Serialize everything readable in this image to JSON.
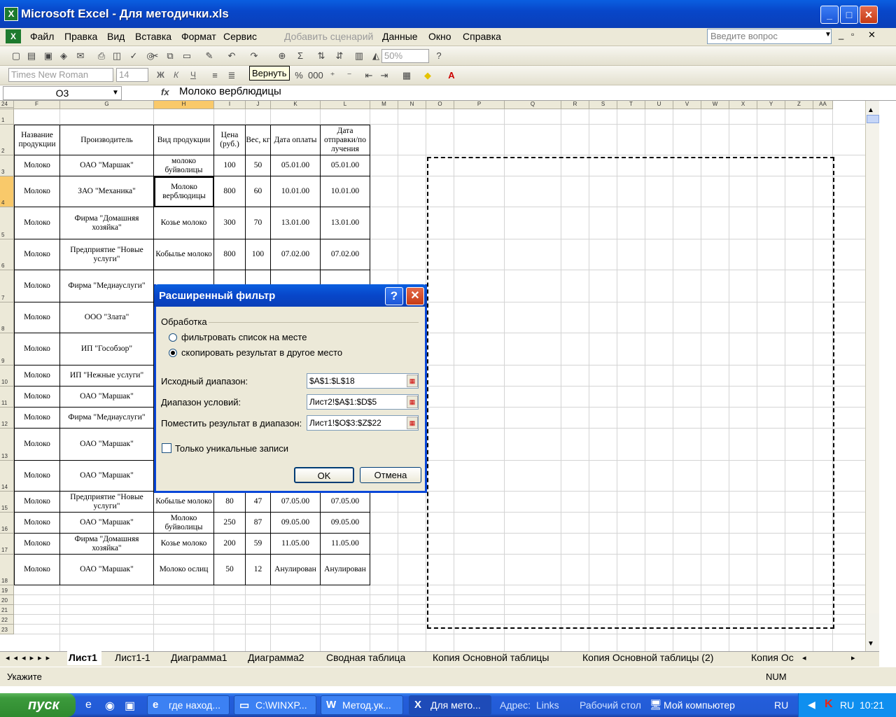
{
  "window": {
    "title": "Microsoft Excel - Для методички.xls"
  },
  "menu": [
    "Файл",
    "Правка",
    "Вид",
    "Вставка",
    "Формат",
    "Сервис",
    "Добавить сценарий",
    "Данные",
    "Окно",
    "Справка"
  ],
  "ask_placeholder": "Введите вопрос",
  "toolbar": {
    "zoom": "50%",
    "font": "Times New Roman",
    "size": "14",
    "tooltip": "Вернуть",
    "bold": "Ж",
    "italic": "К",
    "underline": "Ч"
  },
  "formula": {
    "namebox": "O3",
    "fx": "fx",
    "value": "Молоко верблюдицы"
  },
  "columns": [
    "F",
    "G",
    "H",
    "I",
    "J",
    "K",
    "L",
    "M",
    "N",
    "O",
    "P",
    "Q",
    "R",
    "S",
    "T",
    "U",
    "V",
    "W",
    "X",
    "Y",
    "Z",
    "AA"
  ],
  "rows": [
    "1",
    "2",
    "3",
    "4",
    "5",
    "6",
    "7",
    "8",
    "9",
    "10",
    "11",
    "12",
    "13",
    "14",
    "15",
    "16",
    "17",
    "18",
    "19",
    "20",
    "21",
    "22",
    "23",
    "24"
  ],
  "table": {
    "headers": [
      "Название продукции",
      "Производитель",
      "Вид продукции",
      "Цена (руб.)",
      "Вес, кг",
      "Дата оплаты",
      "Дата отправки/по лучения"
    ],
    "rows": [
      [
        "Молоко",
        "ОАО \"Маршак\"",
        "молоко буйволицы",
        "100",
        "50",
        "05.01.00",
        "05.01.00"
      ],
      [
        "Молоко",
        "ЗАО \"Механика\"",
        "Молоко верблюдицы",
        "800",
        "60",
        "10.01.00",
        "10.01.00"
      ],
      [
        "Молоко",
        "Фирма \"Домашняя хозяйка\"",
        "Козье молоко",
        "300",
        "70",
        "13.01.00",
        "13.01.00"
      ],
      [
        "Молоко",
        "Предприятие \"Новые услуги\"",
        "Кобылье молоко",
        "800",
        "100",
        "07.02.00",
        "07.02.00"
      ],
      [
        "Молоко",
        "Фирма \"Медиауслуги\"",
        "",
        "",
        "",
        "",
        ""
      ],
      [
        "Молоко",
        "ООО \"Злата\"",
        "",
        "",
        "",
        "",
        ""
      ],
      [
        "Молоко",
        "ИП \"Гособзор\"",
        "",
        "",
        "",
        "",
        ""
      ],
      [
        "Молоко",
        "ИП \"Нежные услуги\"",
        "",
        "",
        "",
        "",
        ""
      ],
      [
        "Молоко",
        "ОАО \"Маршак\"",
        "",
        "",
        "",
        "",
        ""
      ],
      [
        "Молоко",
        "Фирма \"Медиауслуги\"",
        "",
        "",
        "",
        "",
        ""
      ],
      [
        "Молоко",
        "ОАО \"Маршак\"",
        "",
        "",
        "",
        "",
        ""
      ],
      [
        "Молоко",
        "ОАО \"Маршак\"",
        "",
        "",
        "",
        "",
        ""
      ],
      [
        "Молоко",
        "Предприятие \"Новые услуги\"",
        "Кобылье молоко",
        "80",
        "47",
        "07.05.00",
        "07.05.00"
      ],
      [
        "Молоко",
        "ОАО \"Маршак\"",
        "Молоко буйволицы",
        "250",
        "87",
        "09.05.00",
        "09.05.00"
      ],
      [
        "Молоко",
        "Фирма \"Домашняя хозяйка\"",
        "Козье молоко",
        "200",
        "59",
        "11.05.00",
        "11.05.00"
      ],
      [
        "Молоко",
        "ОАО \"Маршак\"",
        "Молоко ослиц",
        "50",
        "12",
        "Анулирован",
        "Анулирован"
      ]
    ]
  },
  "dialog": {
    "title": "Расширенный фильтр",
    "group": "Обработка",
    "radio1": "фильтровать список на месте",
    "radio2": "скопировать результат в другое место",
    "selected": "radio2",
    "source_label": "Исходный диапазон:",
    "source_value": "$A$1:$L$18",
    "criteria_label": "Диапазон условий:",
    "criteria_value": "Лист2!$A$1:$D$5",
    "dest_label": "Поместить результат в диапазон:",
    "dest_value": "Лист1!$O$3:$Z$22",
    "unique_label": "Только уникальные записи",
    "unique_checked": false,
    "ok": "OK",
    "cancel": "Отмена"
  },
  "sheets": [
    "Лист1",
    "Лист1-1",
    "Диаграмма1",
    "Диаграмма2",
    "Сводная таблица",
    "Копия Основной таблицы",
    "Копия Основной таблицы (2)",
    "Копия Ос"
  ],
  "active_sheet": "Лист1",
  "status": {
    "left": "Укажите",
    "num": "NUM"
  },
  "taskbar": {
    "start": "пуск",
    "tasks": [
      "где наход...",
      "C:\\WINXP...",
      "Метод.ук...",
      "Для мето..."
    ],
    "address_label": "Адрес:",
    "links": "Links",
    "desktop": "Рабочий стол",
    "mycomp": "Мой компьютер",
    "lang": "RU",
    "lang2": "RU",
    "clock": "10:21"
  }
}
